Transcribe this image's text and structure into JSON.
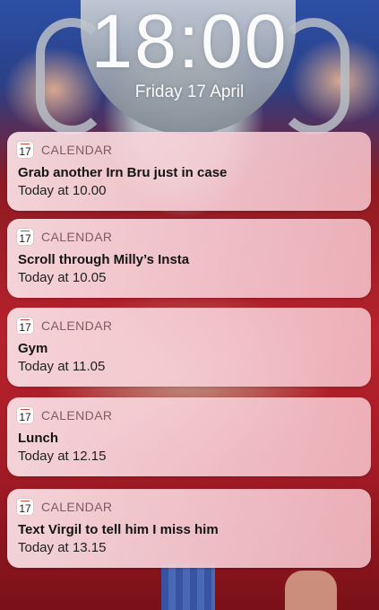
{
  "lockscreen": {
    "time": "18:00",
    "date": "Friday 17 April"
  },
  "calendar_icon": {
    "icon": "calendar-icon",
    "day": "17",
    "accent": "#e0433a"
  },
  "notifications": [
    {
      "app": "CALENDAR",
      "title": "Grab another Irn Bru just in case",
      "time": "Today at 10.00"
    },
    {
      "app": "CALENDAR",
      "title": "Scroll through Milly’s Insta",
      "time": "Today at 10.05"
    },
    {
      "app": "CALENDAR",
      "title": "Gym",
      "time": "Today at 11.05"
    },
    {
      "app": "CALENDAR",
      "title": "Lunch",
      "time": "Today at 12.15"
    },
    {
      "app": "CALENDAR",
      "title": "Text Virgil to tell him I miss him",
      "time": "Today at 13.15"
    }
  ]
}
